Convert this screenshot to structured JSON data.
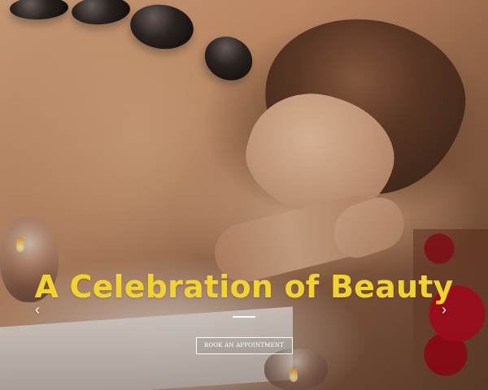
{
  "hero": {
    "title": "A Celebration of Beauty",
    "cta_label": "BOOK AN APPOINTMENT",
    "prev_icon": "chevron-left-icon",
    "next_icon": "chevron-right-icon"
  },
  "colors": {
    "title": "#f2d32e",
    "button_border": "#ffffff",
    "button_text": "#ffffff"
  }
}
